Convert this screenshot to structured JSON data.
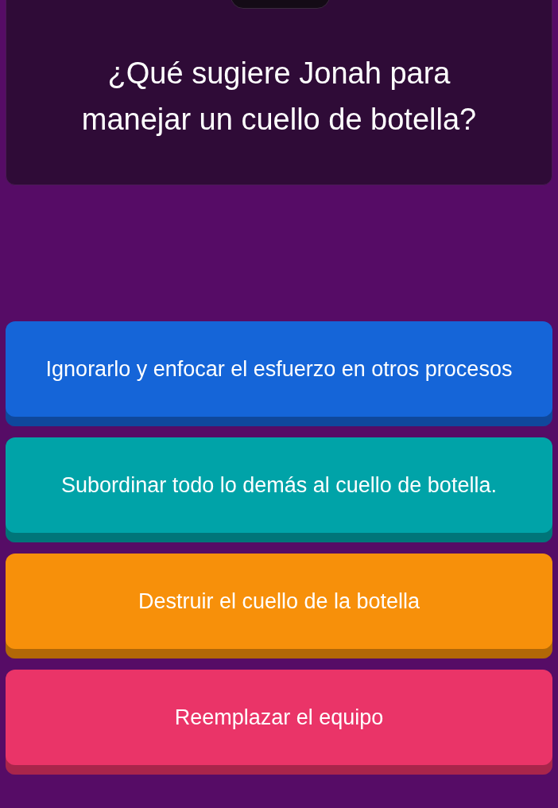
{
  "question": {
    "text": "¿Qué sugiere Jonah para manejar un cuello de botella?"
  },
  "options": [
    {
      "label": "Ignorarlo y enfocar el esfuerzo en otros procesos",
      "color": "#1565d8"
    },
    {
      "label": "Subordinar todo lo demás al cuello de botella.",
      "color": "#00a3a8"
    },
    {
      "label": "Destruir el cuello de la botella",
      "color": "#f7900a"
    },
    {
      "label": "Reemplazar el equipo",
      "color": "#ea3468"
    }
  ]
}
